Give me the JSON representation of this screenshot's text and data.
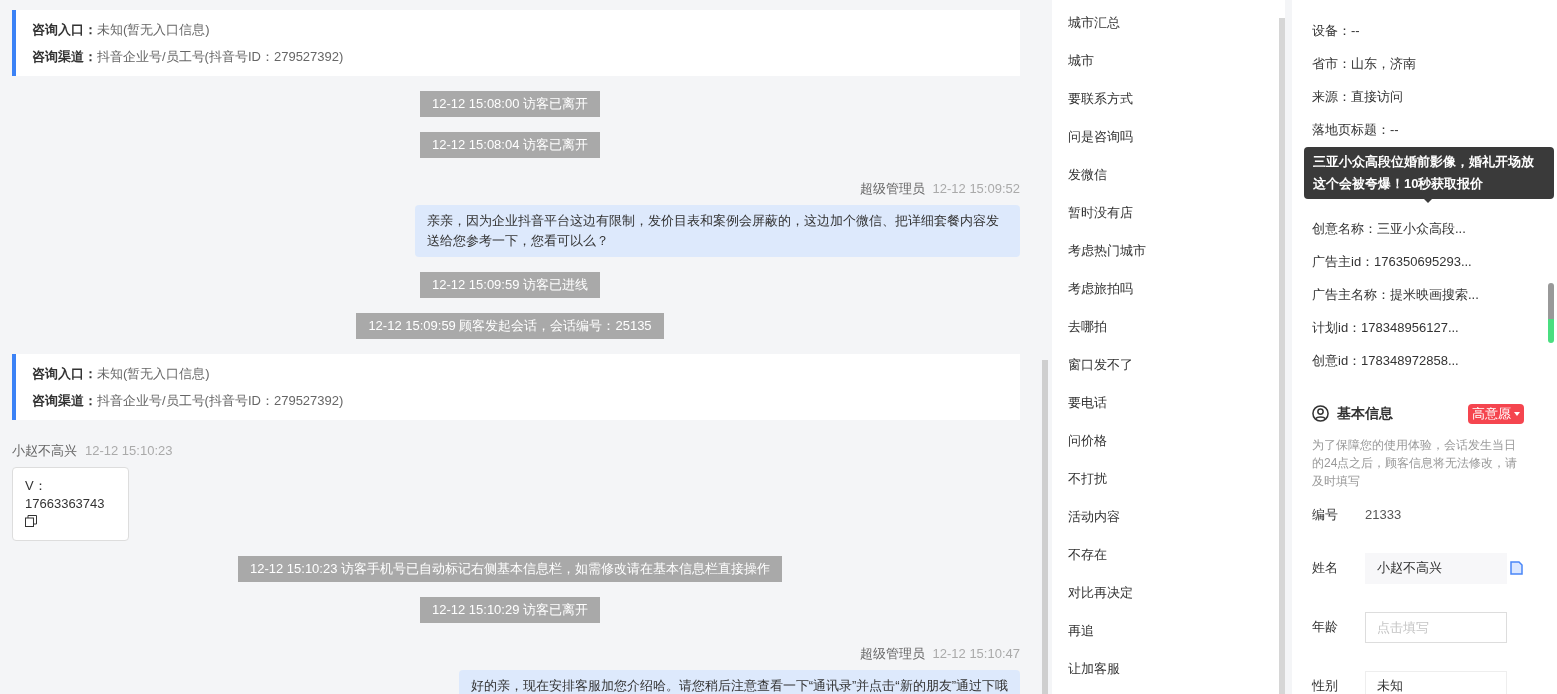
{
  "chat": {
    "messages": [
      {
        "kind": "info",
        "rows": [
          {
            "label": "咨询入口：",
            "value": "未知(暂无入口信息)"
          },
          {
            "label": "咨询渠道：",
            "value": "抖音企业号/员工号(抖音号ID：279527392)"
          }
        ]
      },
      {
        "kind": "system",
        "text": "12-12 15:08:00 访客已离开"
      },
      {
        "kind": "system",
        "text": "12-12 15:08:04 访客已离开"
      },
      {
        "kind": "agent",
        "sender": "超级管理员",
        "time": "12-12 15:09:52",
        "text": "亲亲，因为企业抖音平台这边有限制，发价目表和案例会屏蔽的，这边加个微信、把详细套餐内容发送给您参考一下，您看可以么？"
      },
      {
        "kind": "system",
        "text": "12-12 15:09:59 访客已进线"
      },
      {
        "kind": "system",
        "text": "12-12 15:09:59 顾客发起会话，会话编号：25135"
      },
      {
        "kind": "info",
        "rows": [
          {
            "label": "咨询入口：",
            "value": "未知(暂无入口信息)"
          },
          {
            "label": "咨询渠道：",
            "value": "抖音企业号/员工号(抖音号ID：279527392)"
          }
        ]
      },
      {
        "kind": "visitor",
        "sender": "小赵不高兴",
        "time": "12-12 15:10:23",
        "text": "V：17663363743"
      },
      {
        "kind": "system",
        "text": "12-12 15:10:23 访客手机号已自动标记右侧基本信息栏，如需修改请在基本信息栏直接操作"
      },
      {
        "kind": "system",
        "text": "12-12 15:10:29 访客已离开"
      },
      {
        "kind": "agent",
        "sender": "超级管理员",
        "time": "12-12 15:10:47",
        "text": "好的亲，现在安排客服加您介绍哈。请您稍后注意查看一下“通讯录”并点击“新的朋友”通过下哦"
      }
    ]
  },
  "tag_list": {
    "items": [
      "城市汇总",
      "城市",
      "要联系方式",
      "问是咨询吗",
      "发微信",
      "暂时没有店",
      "考虑热门城市",
      "考虑旅拍吗",
      "去哪拍",
      "窗口发不了",
      "要电话",
      "问价格",
      "不打扰",
      "活动内容",
      "不存在",
      "对比再决定",
      "再追",
      "让加客服"
    ]
  },
  "visit_info": {
    "rows": [
      {
        "kind": "text",
        "text": "设备：--"
      },
      {
        "kind": "text",
        "text": "省市：山东，济南"
      },
      {
        "kind": "text",
        "text": "来源：直接访问"
      },
      {
        "kind": "text",
        "text": "落地页标题：--"
      },
      {
        "kind": "hidden"
      },
      {
        "kind": "hidden"
      },
      {
        "kind": "text",
        "text": "创意名称：三亚小众高段..."
      },
      {
        "kind": "text",
        "text": "广告主id：176350695293..."
      },
      {
        "kind": "text",
        "text": "广告主名称：提米映画搜索..."
      },
      {
        "kind": "text",
        "text": "计划id：178348956127..."
      },
      {
        "kind": "text",
        "text": "创意id：178348972858..."
      }
    ],
    "tooltip": "三亚小众高段位婚前影像，婚礼开场放这个会被夸爆！10秒获取报价"
  },
  "basic_info": {
    "title": "基本信息",
    "intent_tag": "高意愿",
    "note": "为了保障您的使用体验，会话发生当日的24点之后，顾客信息将无法修改，请及时填写",
    "fields": [
      {
        "kind": "static",
        "label": "编号",
        "value": "21333"
      },
      {
        "kind": "filled",
        "label": "姓名",
        "value": "小赵不高兴"
      },
      {
        "kind": "input",
        "label": "年龄",
        "placeholder": "点击填写"
      },
      {
        "kind": "select",
        "label": "性别",
        "value": "未知"
      }
    ]
  }
}
